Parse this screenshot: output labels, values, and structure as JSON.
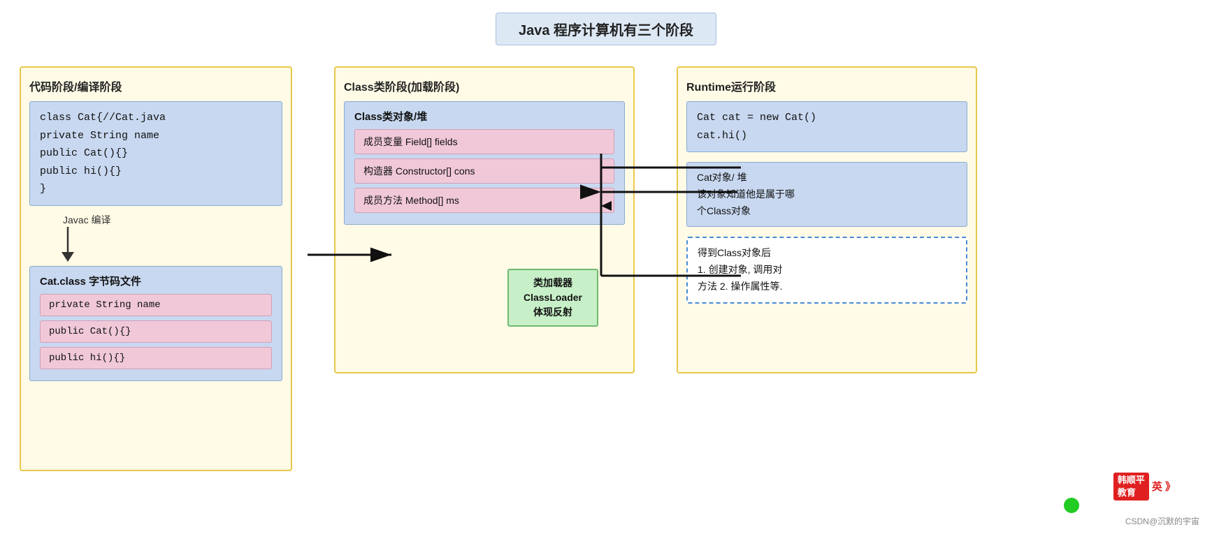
{
  "title": "Java 程序计算机有三个阶段",
  "col1": {
    "title": "代码阶段/编译阶段",
    "code_block": {
      "lines": [
        "class Cat{//Cat.java",
        "private String name",
        "public Cat(){}",
        "public hi(){}",
        "}"
      ]
    },
    "arrow_label": "Javac 编译",
    "bytecode_title": "Cat.class 字节码文件",
    "field_rows": [
      "private String name",
      "public Cat(){}",
      "public hi(){}"
    ]
  },
  "classloader": {
    "line1": "类加载器",
    "line2": "ClassLoader",
    "line3": "体现反射"
  },
  "col2": {
    "title": "Class类阶段(加载阶段)",
    "class_obj_title": "Class类对象/堆",
    "field_rows": [
      "成员变量 Field[] fields",
      "构造器 Constructor[] cons",
      "成员方法 Method[] ms"
    ]
  },
  "col3": {
    "title": "Runtime运行阶段",
    "runtime_code": {
      "lines": [
        "Cat cat = new Cat()",
        "cat.hi()"
      ]
    },
    "heap_box": {
      "lines": [
        "Cat对象/ 堆",
        "该对象知道他是属于哪",
        "个Class对象"
      ]
    },
    "reflect_box": {
      "lines": [
        "得到Class对象后",
        "1. 创建对象, 调用对",
        "方法 2. 操作属性等."
      ]
    }
  },
  "watermark": "CSDN@沉默的宇宙",
  "brand": {
    "name_line1": "韩顺平",
    "name_line2": "教育",
    "suffix": "英 》"
  }
}
